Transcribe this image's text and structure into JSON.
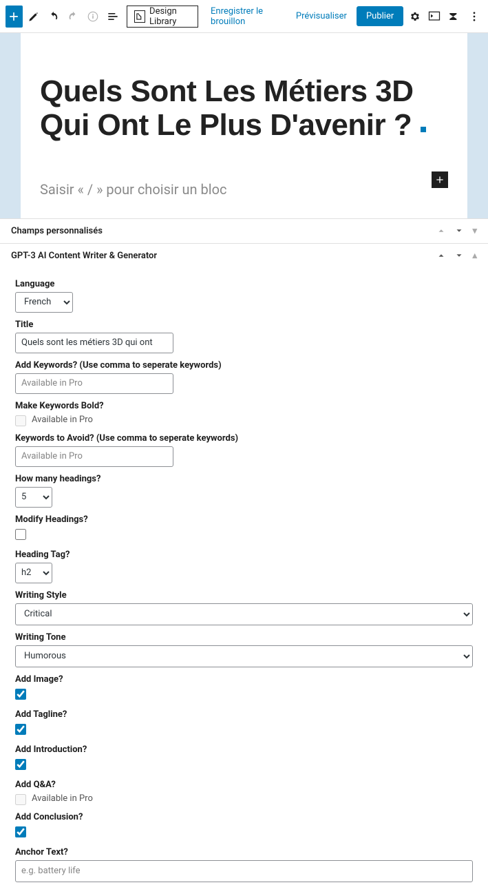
{
  "topbar": {
    "design_library": "Design Library",
    "save_draft": "Enregistrer le brouillon",
    "preview": "Prévisualiser",
    "publish": "Publier"
  },
  "editor": {
    "title": "Quels Sont Les Métiers 3D Qui Ont Le Plus D'avenir ?",
    "slash_hint": "Saisir « / » pour choisir un bloc"
  },
  "panels": {
    "custom_fields": "Champs personnalisés",
    "gpt3": "GPT-3 AI Content Writer & Generator"
  },
  "form": {
    "language_label": "Language",
    "language_value": "French",
    "title_label": "Title",
    "title_value": "Quels sont les métiers 3D qui ont",
    "add_keywords_label": "Add Keywords? (Use comma to seperate keywords)",
    "available_pro": "Available in Pro",
    "make_bold_label": "Make Keywords Bold?",
    "avoid_label": "Keywords to Avoid? (Use comma to seperate keywords)",
    "headings_count_label": "How many headings?",
    "headings_count_value": "5",
    "modify_headings_label": "Modify Headings?",
    "heading_tag_label": "Heading Tag?",
    "heading_tag_value": "h2",
    "writing_style_label": "Writing Style",
    "writing_style_value": "Critical",
    "writing_tone_label": "Writing Tone",
    "writing_tone_value": "Humorous",
    "add_image_label": "Add Image?",
    "add_tagline_label": "Add Tagline?",
    "add_intro_label": "Add Introduction?",
    "add_qna_label": "Add Q&A?",
    "add_conclusion_label": "Add Conclusion?",
    "anchor_label": "Anchor Text?",
    "anchor_placeholder": "e.g. battery life"
  }
}
